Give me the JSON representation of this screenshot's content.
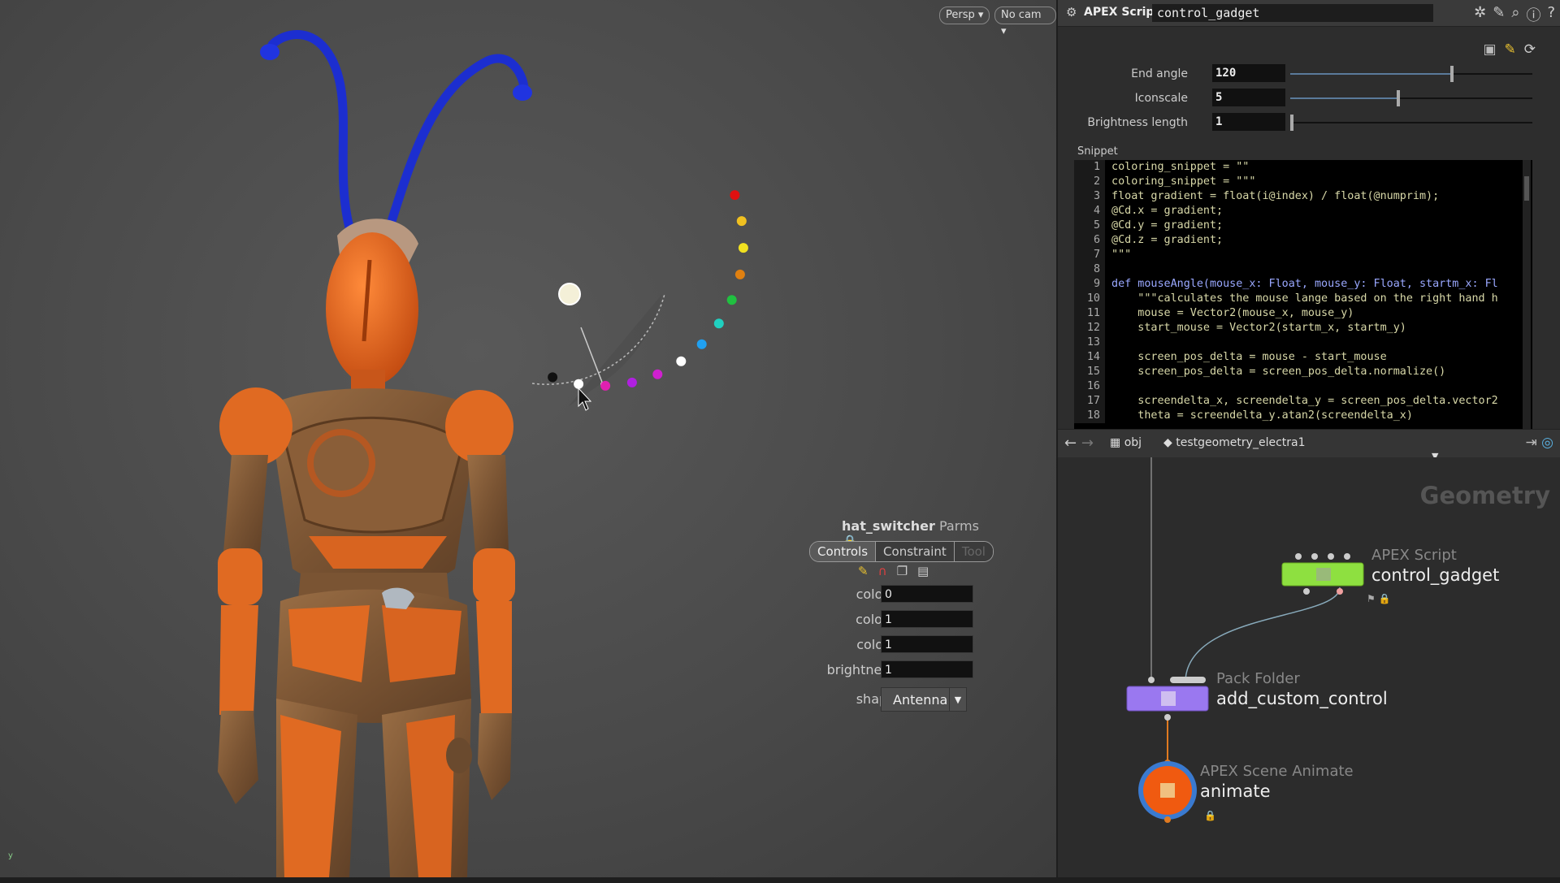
{
  "viewport": {
    "persp_label": "Persp",
    "cam_label": "No cam",
    "axis_label": "y"
  },
  "gadget": {
    "outer_dots": [
      "#e01010",
      "#f0c020",
      "#f0e020",
      "#e08010",
      "#20c040",
      "#20d0c0",
      "#20a0f0",
      "#ffffff",
      "#d020d0",
      "#b020e0",
      "#e020b0",
      "#ffffff",
      "#111111"
    ],
    "handle_color": "#f4f0d8"
  },
  "float_panel": {
    "node_name": "hat_switcher",
    "title_suffix": "Parms",
    "tabs": [
      "Controls",
      "Constraint",
      "Tool"
    ],
    "params": [
      {
        "label": "colorx",
        "value": "0"
      },
      {
        "label": "colory",
        "value": "1"
      },
      {
        "label": "colorz",
        "value": "1"
      },
      {
        "label": "brightness",
        "value": "1"
      }
    ],
    "shape_label": "shape",
    "shape_value": "Antenna"
  },
  "parm_pane": {
    "type_label": "APEX Script",
    "node_name": "control_gadget",
    "params": [
      {
        "label": "End angle",
        "value": "120",
        "slider": 0.66
      },
      {
        "label": "Iconscale",
        "value": "5",
        "slider": 0.44
      },
      {
        "label": "Brightness length",
        "value": "1",
        "slider": 0.0
      }
    ],
    "snippet_label": "Snippet",
    "code_lines": [
      "coloring_snippet = \"\"",
      "coloring_snippet = \"\"\"",
      "float gradient = float(i@index) / float(@numprim);",
      "@Cd.x = gradient;",
      "@Cd.y = gradient;",
      "@Cd.z = gradient;",
      "\"\"\"",
      "",
      "def mouseAngle(mouse_x: Float, mouse_y: Float, startm_x: Fl",
      "    \"\"\"calculates the mouse lange based on the right hand h",
      "    mouse = Vector2(mouse_x, mouse_y)",
      "    start_mouse = Vector2(startm_x, startm_y)",
      "",
      "    screen_pos_delta = mouse - start_mouse",
      "    screen_pos_delta = screen_pos_delta.normalize()",
      "",
      "    screendelta_x, screendelta_y = screen_pos_delta.vector2",
      "    theta = screendelta_y.atan2(screendelta_x)"
    ]
  },
  "network": {
    "path_root": "obj",
    "path_node": "testgeometry_electra1",
    "context_label": "Geometry",
    "nodes": [
      {
        "type": "APEX Script",
        "name": "control_gadget"
      },
      {
        "type": "Pack Folder",
        "name": "add_custom_control"
      },
      {
        "type": "APEX Scene Animate",
        "name": "animate"
      }
    ]
  }
}
